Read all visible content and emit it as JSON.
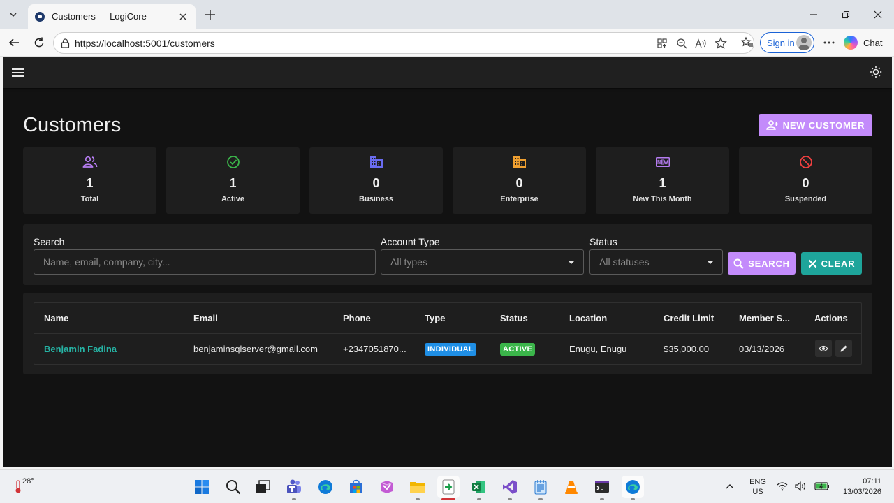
{
  "browser": {
    "tab_title": "Customers — LogiCore",
    "url": "https://localhost:5001/customers",
    "sign_in_label": "Sign in",
    "chat_label": "Chat"
  },
  "page": {
    "title": "Customers",
    "new_customer_label": "NEW CUSTOMER"
  },
  "stats": [
    {
      "value": "1",
      "label": "Total",
      "icon": "people-icon",
      "color": "#b57cf0"
    },
    {
      "value": "1",
      "label": "Active",
      "icon": "check-circle-icon",
      "color": "#3bb54a"
    },
    {
      "value": "0",
      "label": "Business",
      "icon": "building-icon",
      "color": "#6a6cf0"
    },
    {
      "value": "0",
      "label": "Enterprise",
      "icon": "office-building-icon",
      "color": "#f0a030"
    },
    {
      "value": "1",
      "label": "New This Month",
      "icon": "new-badge-icon",
      "color": "#b57cf0"
    },
    {
      "value": "0",
      "label": "Suspended",
      "icon": "block-icon",
      "color": "#f04040"
    }
  ],
  "filters": {
    "search_label": "Search",
    "search_placeholder": "Name, email, company, city...",
    "account_type_label": "Account Type",
    "account_type_value": "All types",
    "status_label": "Status",
    "status_value": "All statuses",
    "search_button": "SEARCH",
    "clear_button": "CLEAR"
  },
  "table": {
    "columns": [
      "Name",
      "Email",
      "Phone",
      "Type",
      "Status",
      "Location",
      "Credit Limit",
      "Member S...",
      "Actions"
    ],
    "rows": [
      {
        "name": "Benjamin Fadina",
        "email": "benjaminsqlserver@gmail.com",
        "phone": "+2347051870...",
        "type": "INDIVIDUAL",
        "status": "ACTIVE",
        "location": "Enugu, Enugu",
        "credit_limit": "$35,000.00",
        "member_since": "03/13/2026"
      }
    ]
  },
  "colors": {
    "primary": "#c38bfb",
    "secondary": "#1ea59b",
    "link": "#26b5a6",
    "type_chip": "#1f8fe6",
    "status_chip": "#3bb54a",
    "surface": "#1e1e1e",
    "background": "#121212"
  },
  "taskbar": {
    "temperature": "28°",
    "lang_line1": "ENG",
    "lang_line2": "US",
    "time": "07:11",
    "date": "13/03/2026"
  }
}
